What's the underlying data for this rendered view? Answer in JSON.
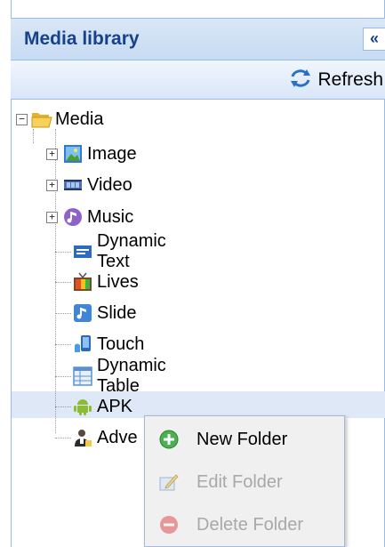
{
  "header": {
    "title": "Media library",
    "collapse_symbol": "«"
  },
  "toolbar": {
    "refresh_label": "Refresh"
  },
  "tree": {
    "root": {
      "label": "Media",
      "expanded": true
    },
    "items": [
      {
        "label": "Image",
        "icon": "image-icon",
        "expandable": true
      },
      {
        "label": "Video",
        "icon": "video-icon",
        "expandable": true
      },
      {
        "label": "Music",
        "icon": "music-icon",
        "expandable": true
      },
      {
        "label": "Dynamic Text",
        "icon": "dynamic-text-icon",
        "expandable": false
      },
      {
        "label": "Lives",
        "icon": "tv-icon",
        "expandable": false
      },
      {
        "label": "Slide",
        "icon": "slide-icon",
        "expandable": false
      },
      {
        "label": "Touch",
        "icon": "touch-icon",
        "expandable": false
      },
      {
        "label": "Dynamic Table",
        "icon": "table-icon",
        "expandable": false
      },
      {
        "label": "APK",
        "icon": "android-icon",
        "expandable": false,
        "selected": true
      },
      {
        "label": "Adve",
        "icon": "advertiser-icon",
        "expandable": false
      }
    ]
  },
  "context_menu": {
    "items": [
      {
        "label": "New Folder",
        "icon": "add-icon",
        "enabled": true
      },
      {
        "label": "Edit Folder",
        "icon": "edit-icon",
        "enabled": false
      },
      {
        "label": "Delete Folder",
        "icon": "delete-icon",
        "enabled": false
      }
    ]
  },
  "colors": {
    "header_text": "#15428b",
    "border": "#99bbe8",
    "selection": "#dfe8f6"
  }
}
